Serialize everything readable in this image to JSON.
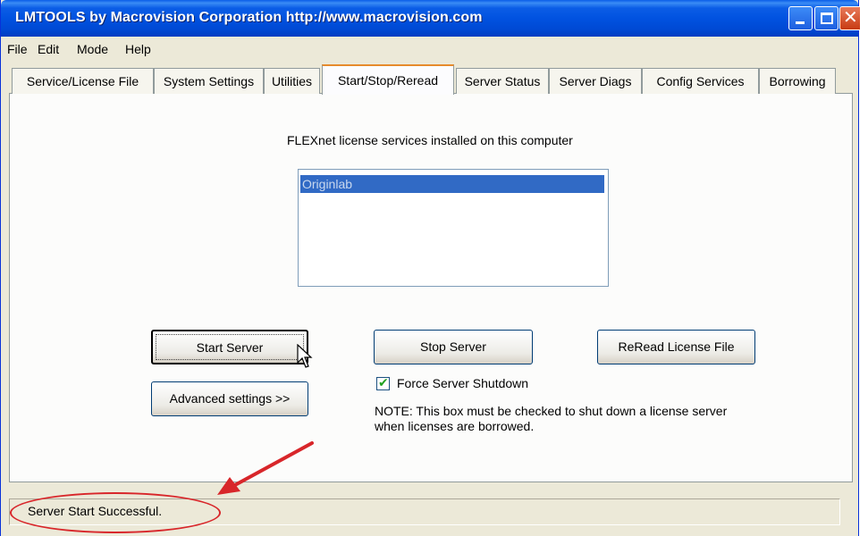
{
  "window": {
    "title": "LMTOOLS by Macrovision Corporation http://www.macrovision.com"
  },
  "menu": [
    "File",
    "Edit",
    "Mode",
    "Help"
  ],
  "tabs": [
    {
      "label": "Service/License File",
      "active": false
    },
    {
      "label": "System Settings",
      "active": false
    },
    {
      "label": "Utilities",
      "active": false
    },
    {
      "label": "Start/Stop/Reread",
      "active": true
    },
    {
      "label": "Server Status",
      "active": false
    },
    {
      "label": "Server Diags",
      "active": false
    },
    {
      "label": "Config Services",
      "active": false
    },
    {
      "label": "Borrowing",
      "active": false
    }
  ],
  "main": {
    "installed_label": "FLEXnet license services installed on this computer",
    "services": [
      {
        "label": "Originlab",
        "selected": true
      }
    ],
    "start_server": "Start Server",
    "advanced_settings": "Advanced settings >>",
    "stop_server": "Stop Server",
    "reread_license": "ReRead License File",
    "force_shutdown": {
      "label": "Force Server Shutdown",
      "checked": true
    },
    "note_line1": "NOTE:  This box must be checked to shut down a license server",
    "note_line2": "when licenses are borrowed."
  },
  "status": {
    "text": "Server Start Successful."
  },
  "colors": {
    "titlebar": "#0152e0",
    "selection": "#316ac5",
    "active_tab_accent": "#e68b2c",
    "annotation": "#d8262a"
  }
}
